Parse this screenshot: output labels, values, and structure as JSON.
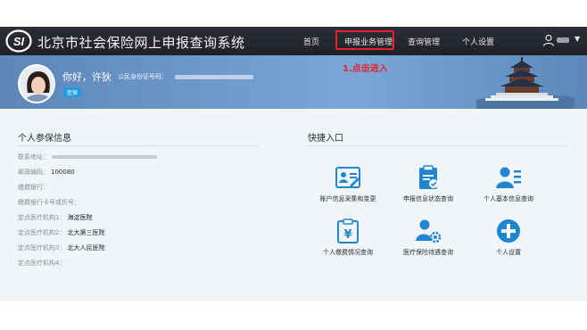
{
  "header": {
    "logo_text": "SI",
    "title": "北京市社会保险网上申报查询系统",
    "nav": [
      {
        "label": "首页"
      },
      {
        "label": "申报业务管理"
      },
      {
        "label": "查询管理"
      },
      {
        "label": "个人设置"
      }
    ],
    "user_caret": "▼"
  },
  "banner": {
    "greeting": "你好，许狄",
    "id_label": "公民身份证号码：",
    "badge": "医保",
    "hint": "1.点击进入"
  },
  "personal_info": {
    "title": "个人参保信息",
    "rows": [
      {
        "label": "联系地址：",
        "value": ""
      },
      {
        "label": "邮政编码：",
        "value": "100080"
      },
      {
        "label": "缴费银行：",
        "value": ""
      },
      {
        "label": "缴费银行卡号或折号：",
        "value": ""
      },
      {
        "label": "定点医疗机构1：",
        "value": "海淀医院"
      },
      {
        "label": "定点医疗机构2：",
        "value": "北大第三医院"
      },
      {
        "label": "定点医疗机构3：",
        "value": "北大人民医院"
      },
      {
        "label": "定点医疗机构4：",
        "value": ""
      }
    ]
  },
  "quick_entry": {
    "title": "快捷入口",
    "items": [
      {
        "label": "账户信息采集和变更",
        "icon": "account-card-icon"
      },
      {
        "label": "申报信息状态查询",
        "icon": "clipboard-check-icon"
      },
      {
        "label": "个人基本信息查询",
        "icon": "person-list-icon"
      },
      {
        "label": "个人缴费情况查询",
        "icon": "payment-clipboard-icon"
      },
      {
        "label": "医疗保险待遇查询",
        "icon": "person-gear-icon"
      },
      {
        "label": "个人设置",
        "icon": "plus-circle-icon"
      }
    ]
  },
  "colors": {
    "topbar": "#23252c",
    "banner": "#6d98c8",
    "accent_blue": "#1f86d0",
    "highlight_red": "#e5212b",
    "content_bg": "#f1f4f8"
  }
}
